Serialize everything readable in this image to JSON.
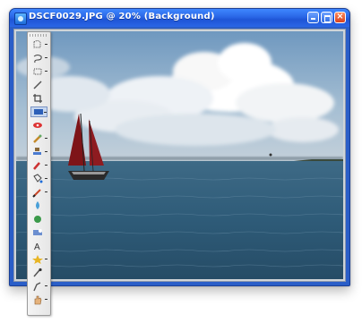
{
  "window": {
    "title": "DSCF0029.JPG @ 20% (Background)",
    "title_color": "#ffffff",
    "titlebar_color": "#2a66e6",
    "controls": [
      "minimize-icon",
      "maximize-icon",
      "close-icon"
    ]
  },
  "document": {
    "zoom": "20%",
    "layer": "Background",
    "content": "photo of sailboat on the sea under clouds"
  },
  "colors": {
    "sky": "#8fb1cc",
    "sea": "#2f5875",
    "sail": "#8a1a1e",
    "toolbar": "#eeeeee"
  },
  "tools": [
    {
      "name": "marquee-tool-icon",
      "has_flyout": true
    },
    {
      "name": "lasso-tool-icon",
      "has_flyout": true
    },
    {
      "name": "rectangle-tool-icon",
      "has_flyout": true
    },
    {
      "name": "pencil-tool-icon",
      "has_flyout": false
    },
    {
      "name": "crop-tool-icon",
      "has_flyout": false
    },
    {
      "name": "selection-brush-icon",
      "has_flyout": true,
      "active": true
    },
    {
      "name": "red-eye-tool-icon",
      "has_flyout": false
    },
    {
      "name": "healing-brush-icon",
      "has_flyout": true
    },
    {
      "name": "clone-stamp-icon",
      "has_flyout": true
    },
    {
      "name": "eraser-tool-icon",
      "has_flyout": true
    },
    {
      "name": "paint-bucket-icon",
      "has_flyout": true
    },
    {
      "name": "brush-tool-icon",
      "has_flyout": true
    },
    {
      "name": "blur-tool-icon",
      "has_flyout": false
    },
    {
      "name": "sponge-tool-icon",
      "has_flyout": false
    },
    {
      "name": "gradient-tool-icon",
      "has_flyout": false
    },
    {
      "name": "text-tool-icon",
      "has_flyout": false
    },
    {
      "name": "shape-tool-icon",
      "has_flyout": true
    },
    {
      "name": "eyedropper-tool-icon",
      "has_flyout": false
    },
    {
      "name": "smudge-tool-icon",
      "has_flyout": true
    },
    {
      "name": "hand-tool-icon",
      "has_flyout": true
    }
  ]
}
